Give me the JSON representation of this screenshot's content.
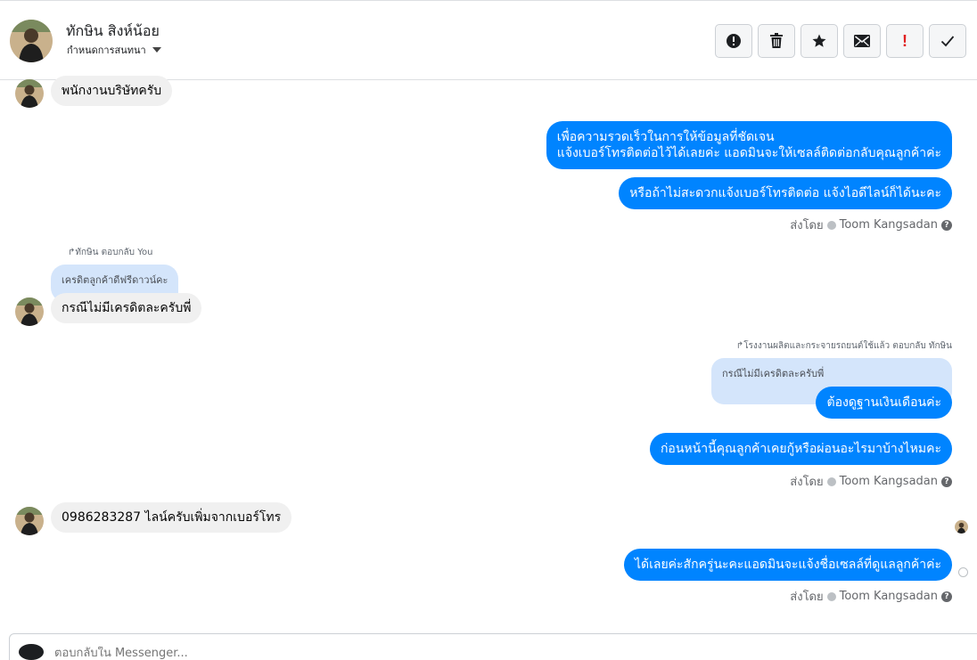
{
  "header": {
    "contact_name": "ทักษิน สิงห์น้อย",
    "assign_label": "กำหนดการสนทนา"
  },
  "toolbar": {
    "buttons": [
      "alert-circle-icon",
      "trash-icon",
      "star-icon",
      "envelope-icon",
      "exclamation-icon",
      "check-icon"
    ],
    "exclamation_text": "!"
  },
  "messages": {
    "m1": "พนักงานบริษัทครับ",
    "m2_line1": "เพื่อความรวดเร็วในการให้ข้อมูลที่ชัดเจน",
    "m2_line2": "แจ้งเบอร์โทรติดต่อไว้ได้เลยค่ะ แอดมินจะให้เซลล์ติดต่อกลับคุณลูกค้าค่ะ",
    "m3": "หรือถ้าไม่สะดวกแจ้งเบอร์โทรติดต่อ แจ้งไอดีไลน์ก็ได้นะคะ",
    "sent_by_1": "ส่งโดย",
    "sender_1": "Toom Kangsadan",
    "reply_ctx_1": "ทักษิน ตอบกลับ You",
    "quote_1": "เครดิตลูกค้าดีฟรีดาวน์คะ",
    "m4": "กรณีไม่มีเครดิตละครับพี่",
    "reply_ctx_2": "โรงงานผลิตและกระจายรถยนต์ใช้แล้ว ตอบกลับ ทักษิน",
    "quote_2": "กรณีไม่มีเครดิตละครับพี่",
    "m5": "ต้องดูฐานเงินเดือนค่ะ",
    "m6": "ก่อนหน้านี้คุณลูกค้าเคยกู้หรือผ่อนอะไรมาบ้างไหมคะ",
    "sent_by_2": "ส่งโดย",
    "sender_2": "Toom Kangsadan",
    "m7": "0986283287 ไลน์ครับเพิ่มจากเบอร์โทร",
    "m8": "ได้เลยค่ะสักครู่นะคะแอดมินจะแจ้งชื่อเซลล์ที่ดูแลลูกค้าค่ะ",
    "sent_by_3": "ส่งโดย",
    "sender_3": "Toom Kangsadan",
    "help_glyph": "?"
  },
  "composer": {
    "placeholder": "ตอบกลับใน Messenger..."
  },
  "colors": {
    "outgoing_bubble": "#0084ff",
    "incoming_bubble": "#f0f0f0",
    "quote_bubble": "#d4e5fb"
  }
}
